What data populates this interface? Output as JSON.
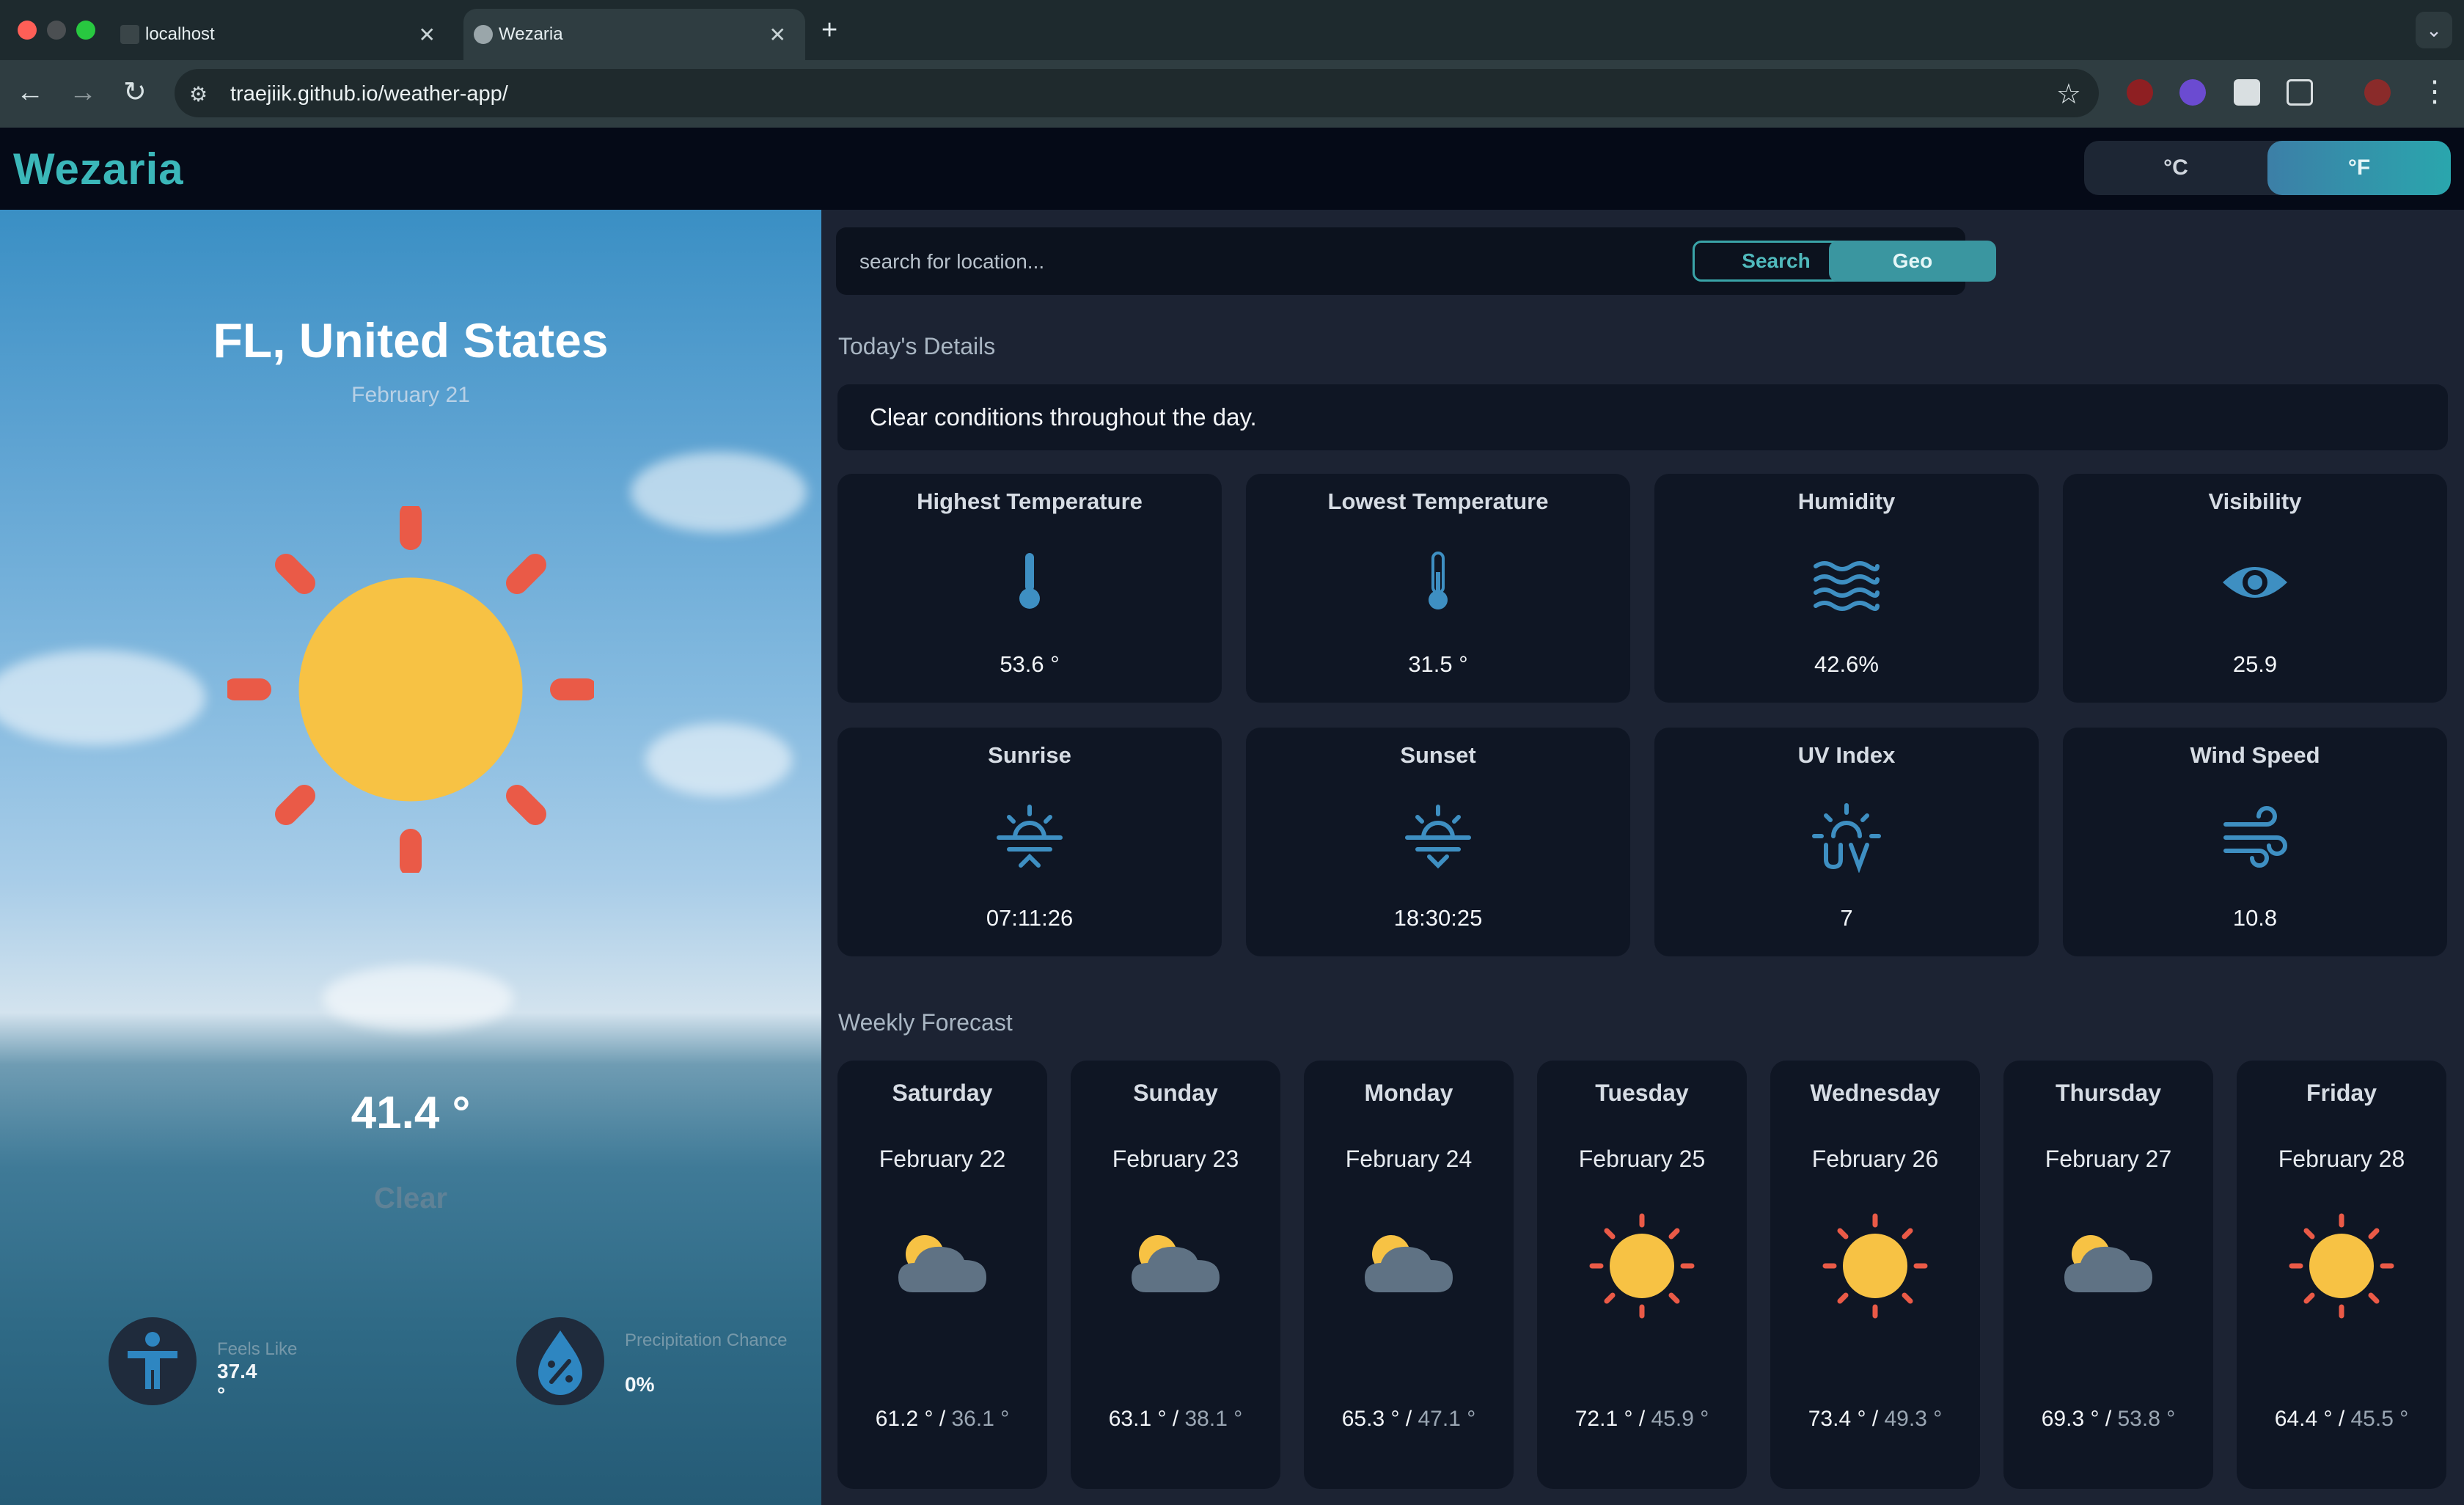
{
  "browser": {
    "tabs": [
      {
        "title": "localhost",
        "active": false
      },
      {
        "title": "Wezaria",
        "active": true
      }
    ],
    "url": "traejiik.github.io/weather-app/"
  },
  "app": {
    "logo": "Wezaria",
    "units": {
      "celsius": "°C",
      "fahrenheit": "°F",
      "selected": "°F"
    }
  },
  "hero": {
    "location": "FL, United States",
    "date": "February 21",
    "icon": "sun-icon",
    "temperature": "41.4 °",
    "condition": "Clear",
    "feels_like": {
      "label": "Feels Like",
      "value": "37.4 °",
      "icon": "accessibility-icon"
    },
    "precip": {
      "label": "Precipitation Chance",
      "value": "0%",
      "icon": "percent-drop-icon"
    }
  },
  "search": {
    "placeholder": "search for location...",
    "search_label": "Search",
    "geo_label": "Geo"
  },
  "today": {
    "title": "Today's Details",
    "summary": "Clear conditions throughout the day.",
    "cards": [
      {
        "title": "Highest Temperature",
        "value": "53.6 °",
        "icon": "thermometer-icon"
      },
      {
        "title": "Lowest Temperature",
        "value": "31.5 °",
        "icon": "thermometer-icon"
      },
      {
        "title": "Humidity",
        "value": "42.6%",
        "icon": "waves-icon"
      },
      {
        "title": "Visibility",
        "value": "25.9",
        "icon": "eye-icon"
      },
      {
        "title": "Sunrise",
        "value": "07:11:26",
        "icon": "sunrise-icon"
      },
      {
        "title": "Sunset",
        "value": "18:30:25",
        "icon": "sunset-icon"
      },
      {
        "title": "UV Index",
        "value": "7",
        "icon": "uv-icon"
      },
      {
        "title": "Wind Speed",
        "value": "10.8",
        "icon": "wind-icon"
      }
    ]
  },
  "weekly": {
    "title": "Weekly Forecast",
    "days": [
      {
        "day": "Saturday",
        "date": "February 22",
        "hi": "61.2 °",
        "lo": "36.1 °",
        "icon": "partly-cloudy-icon"
      },
      {
        "day": "Sunday",
        "date": "February 23",
        "hi": "63.1 °",
        "lo": "38.1 °",
        "icon": "partly-cloudy-icon"
      },
      {
        "day": "Monday",
        "date": "February 24",
        "hi": "65.3 °",
        "lo": "47.1 °",
        "icon": "partly-cloudy-icon"
      },
      {
        "day": "Tuesday",
        "date": "February 25",
        "hi": "72.1 °",
        "lo": "45.9 °",
        "icon": "sun-icon"
      },
      {
        "day": "Wednesday",
        "date": "February 26",
        "hi": "73.4 °",
        "lo": "49.3 °",
        "icon": "sun-icon"
      },
      {
        "day": "Thursday",
        "date": "February 27",
        "hi": "69.3 °",
        "lo": "53.8 °",
        "icon": "partly-cloudy-icon"
      },
      {
        "day": "Friday",
        "date": "February 28",
        "hi": "64.4 °",
        "lo": "45.5 °",
        "icon": "sun-icon"
      }
    ]
  },
  "colors": {
    "accent": "#3bb7b9",
    "card": "#0f1624",
    "icon_blue": "#3e8fc2",
    "sun": "#f7c244",
    "ray": "#ea5a47"
  }
}
